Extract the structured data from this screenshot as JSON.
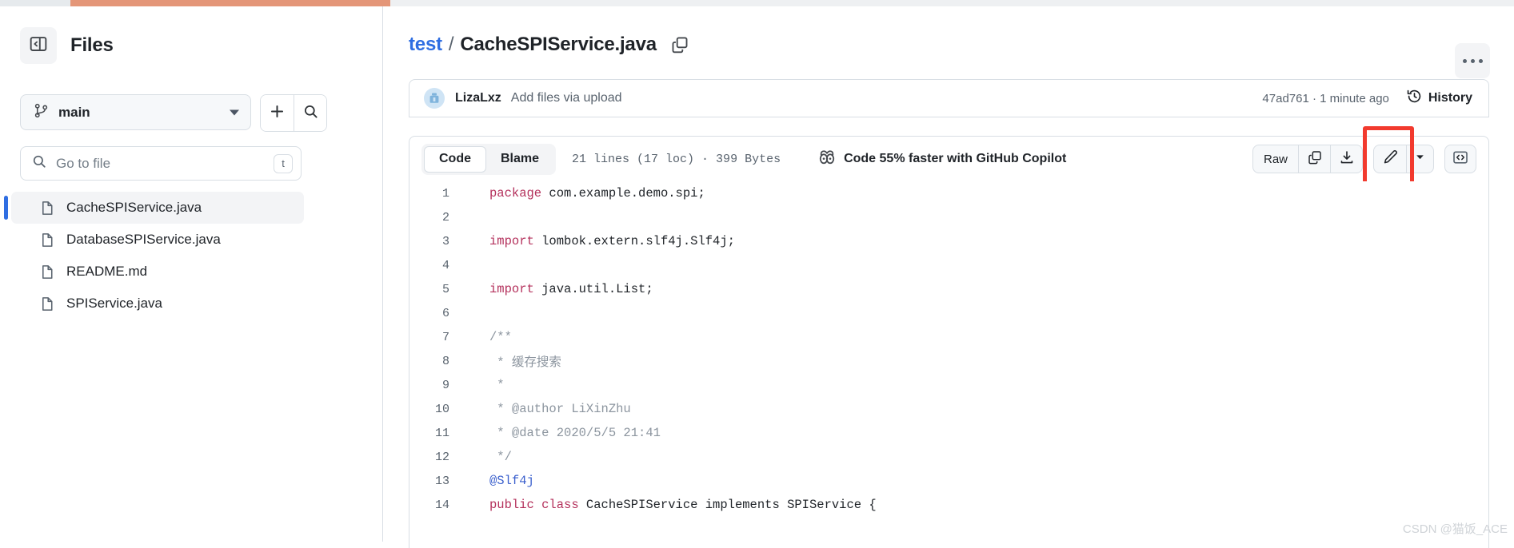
{
  "topbar": {
    "progress_color": "#e49678"
  },
  "sidebar": {
    "toggle_icon": "sidebar-collapse-icon",
    "title": "Files",
    "branch": {
      "icon": "git-branch-icon",
      "name": "main",
      "caret_icon": "chevron-down-icon"
    },
    "add_button_icon": "plus-icon",
    "search_button_icon": "search-icon",
    "search": {
      "icon": "search-icon",
      "placeholder": "Go to file",
      "value": "",
      "shortcut": "t"
    },
    "files": [
      {
        "name": "CacheSPIService.java",
        "selected": true
      },
      {
        "name": "DatabaseSPIService.java",
        "selected": false
      },
      {
        "name": "README.md",
        "selected": false
      },
      {
        "name": "SPIService.java",
        "selected": false
      }
    ]
  },
  "header": {
    "repo": "test",
    "separator": "/",
    "filename": "CacheSPIService.java",
    "copy_icon": "copy-path-icon",
    "kebab_icon": "more-options-icon"
  },
  "commit": {
    "avatar": "user-avatar",
    "author": "LizaLxz",
    "message": "Add files via upload",
    "sha_and_time": "47ad761 · 1 minute ago",
    "history_icon": "history-clock-icon",
    "history_label": "History"
  },
  "toolbar": {
    "tabs": [
      {
        "label": "Code",
        "active": true
      },
      {
        "label": "Blame",
        "active": false
      }
    ],
    "loc_info": "21 lines (17 loc) · 399 Bytes",
    "copilot_icon": "copilot-icon",
    "copilot_label": "Code 55% faster with GitHub Copilot",
    "raw_label": "Raw",
    "copy_icon": "copy-icon",
    "download_icon": "download-icon",
    "edit_icon": "pencil-edit-icon",
    "edit_caret_icon": "chevron-down-icon",
    "symbols_icon": "code-symbols-icon",
    "highlight_color": "#f23a2e"
  },
  "code": {
    "lines": [
      {
        "n": "1",
        "tokens": [
          {
            "t": "package",
            "c": "kw"
          },
          {
            "t": " com.example.demo.spi;",
            "c": ""
          }
        ]
      },
      {
        "n": "2",
        "tokens": []
      },
      {
        "n": "3",
        "tokens": [
          {
            "t": "import",
            "c": "kw"
          },
          {
            "t": " lombok.extern.slf4j.Slf4j;",
            "c": ""
          }
        ]
      },
      {
        "n": "4",
        "tokens": []
      },
      {
        "n": "5",
        "tokens": [
          {
            "t": "import",
            "c": "kw"
          },
          {
            "t": " java.util.List;",
            "c": ""
          }
        ]
      },
      {
        "n": "6",
        "tokens": []
      },
      {
        "n": "7",
        "tokens": [
          {
            "t": "/**",
            "c": "cm"
          }
        ]
      },
      {
        "n": "8",
        "tokens": [
          {
            "t": " * 缓存搜索",
            "c": "cm"
          }
        ]
      },
      {
        "n": "9",
        "tokens": [
          {
            "t": " *",
            "c": "cm"
          }
        ]
      },
      {
        "n": "10",
        "tokens": [
          {
            "t": " * @author LiXinZhu",
            "c": "cm"
          }
        ]
      },
      {
        "n": "11",
        "tokens": [
          {
            "t": " * @date 2020/5/5 21:41",
            "c": "cm"
          }
        ]
      },
      {
        "n": "12",
        "tokens": [
          {
            "t": " */",
            "c": "cm"
          }
        ]
      },
      {
        "n": "13",
        "tokens": [
          {
            "t": "@Slf4j",
            "c": "an"
          }
        ]
      },
      {
        "n": "14",
        "tokens": [
          {
            "t": "public class ",
            "c": "kw"
          },
          {
            "t": "CacheSPIService implements SPIService {",
            "c": ""
          }
        ]
      }
    ]
  },
  "watermark": "CSDN @猫饭_ACE"
}
